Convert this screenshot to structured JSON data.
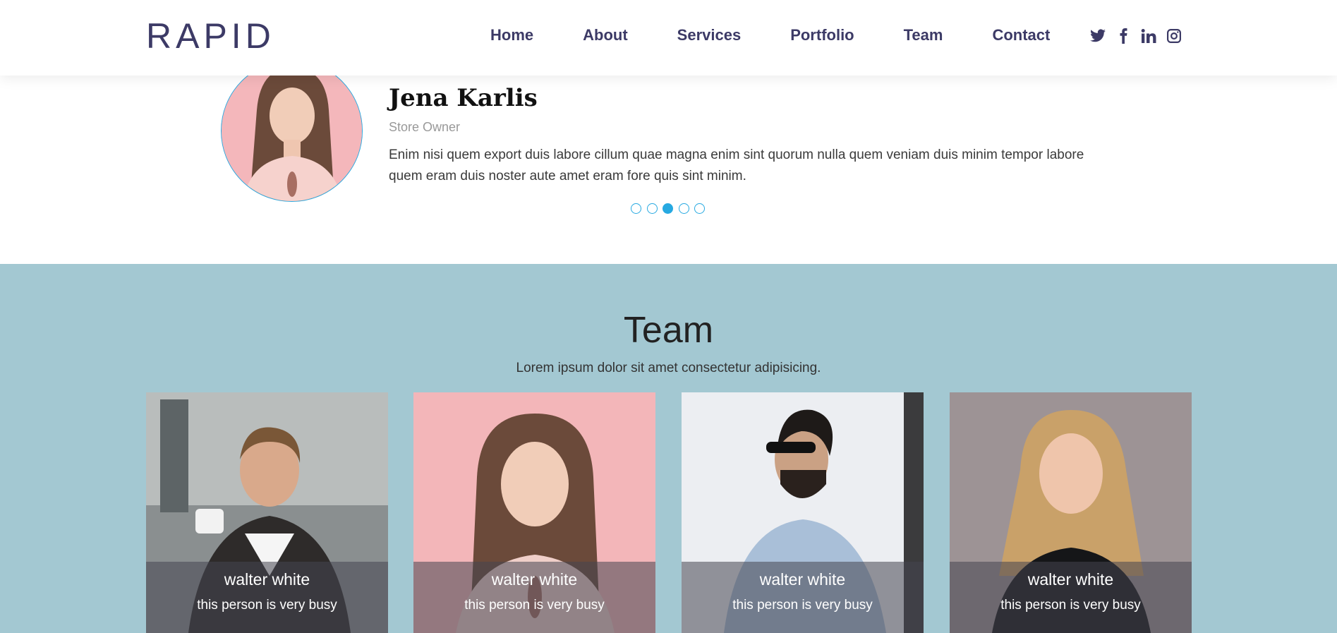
{
  "header": {
    "logo": "RAPID",
    "nav": [
      "Home",
      "About",
      "Services",
      "Portfolio",
      "Team",
      "Contact"
    ],
    "social_icons": [
      "twitter-icon",
      "facebook-icon",
      "linkedin-icon",
      "instagram-icon"
    ]
  },
  "testimonial": {
    "name": "Jena Karlis",
    "role": "Store Owner",
    "text": "Enim nisi quem export duis labore cillum quae magna enim sint quorum nulla quem veniam duis minim tempor labore quem eram duis noster aute amet eram fore quis sint minim.",
    "dots_count": 5,
    "active_dot": 3
  },
  "team": {
    "title": "Team",
    "subtitle": "Lorem ipsum dolor sit amet consectetur adipisicing.",
    "members": [
      {
        "name": "walter white",
        "desc": "this person is very busy"
      },
      {
        "name": "walter white",
        "desc": "this person is very busy"
      },
      {
        "name": "walter white",
        "desc": "this person is very busy"
      },
      {
        "name": "walter white",
        "desc": "this person is very busy"
      }
    ]
  },
  "colors": {
    "brand": "#3c3a66",
    "accent": "#27a9e1",
    "team_bg": "#a3c8d2"
  }
}
